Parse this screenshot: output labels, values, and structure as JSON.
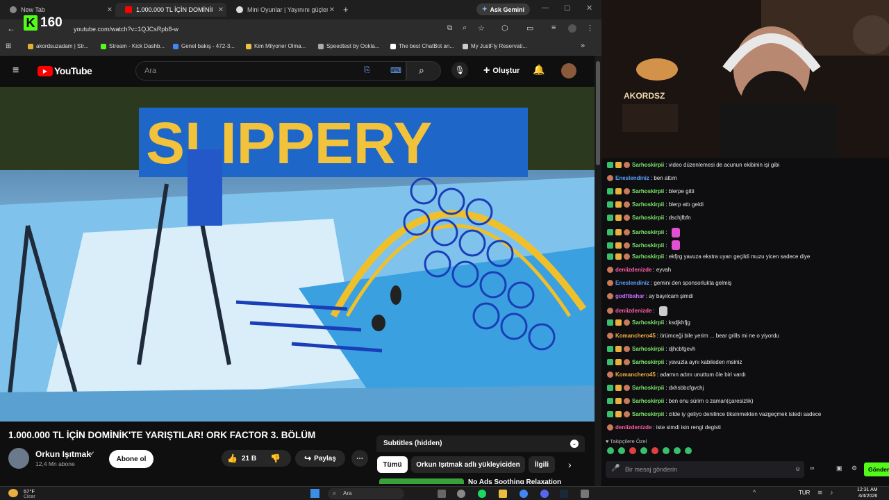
{
  "browser": {
    "tabs": [
      {
        "label": "New Tab",
        "color": "#888"
      },
      {
        "label": "1.000.000 TL İÇİN DOMİNİK",
        "color": "#ff0000"
      },
      {
        "label": "Mini Oyunlar | Yayınını güçlend",
        "color": "#ddd"
      }
    ],
    "ask_gemini": "Ask Gemini",
    "url": "youtube.com/watch?v=1QJCsRpb8-w",
    "bookmarks": [
      {
        "label": "akordsuzadam | Str...",
        "color": "#e0b030"
      },
      {
        "label": "Stream - Kick Dashb...",
        "color": "#53fc18"
      },
      {
        "label": "Genel bakış - 472-3...",
        "color": "#4285f4"
      },
      {
        "label": "Kim Milyoner Olma...",
        "color": "#f0c040"
      },
      {
        "label": "Speedtest by Ookla...",
        "color": "#aaa"
      },
      {
        "label": "The best ChatBot an...",
        "color": "#fff"
      },
      {
        "label": "My JustFly Reservati...",
        "color": "#ccc"
      }
    ]
  },
  "kick_badge": {
    "count": "160"
  },
  "youtube": {
    "logo_text": "YouTube",
    "search_placeholder": "Ara",
    "create_label": "Oluştur",
    "video_title": "1.000.000 TL İÇİN DOMİNİK'TE YARIŞTILAR! ORK FACTOR 3. BÖLÜM",
    "channel": "Orkun Işıtmak",
    "subscribers": "12,4 Mn abone",
    "subscribe_label": "Abone ol",
    "likes": "21 B",
    "share_label": "Paylaş",
    "subtitles": "Subtitles (hidden)",
    "chips": [
      "Tümü",
      "Orkun Işıtmak adlı yükleyiciden",
      "İlgili"
    ],
    "next_video": "No Ads Soothing Relaxation",
    "video_sign": "SLIPPERY"
  },
  "chat": {
    "messages": [
      {
        "user": "Sarhoskirpii",
        "text": "video düzenlemesi de acunun ekibinin işi gibi",
        "ucolor": "#7ee86b",
        "badges": true
      },
      {
        "user": "Eneslendiniz",
        "text": "ben attım",
        "ucolor": "#5aa0ff",
        "badges": false
      },
      {
        "user": "Sarhoskirpii",
        "text": "blerpe gitti",
        "ucolor": "#7ee86b",
        "badges": true
      },
      {
        "user": "Sarhoskirpii",
        "text": "blerp attı geldi",
        "ucolor": "#7ee86b",
        "badges": true
      },
      {
        "user": "Sarhoskirpii",
        "text": "dschjfbfn",
        "ucolor": "#7ee86b",
        "badges": true
      },
      {
        "user": "Sarhoskirpii",
        "text": "",
        "ucolor": "#7ee86b",
        "badges": true,
        "emote": "#e050d0"
      },
      {
        "user": "Sarhoskirpii",
        "text": "",
        "ucolor": "#7ee86b",
        "badges": true,
        "emote": "#e050d0"
      },
      {
        "user": "Sarhoskirpii",
        "text": "ekfjrg yavuza ekstra uyarı geçildi muzu yicen sadece diye",
        "ucolor": "#7ee86b",
        "badges": true
      },
      {
        "user": "deniizdenizde",
        "text": "eyvah",
        "ucolor": "#ff5fa8",
        "badges": false
      },
      {
        "user": "Eneslendiniz",
        "text": "gemini den sponsorlukta gelmiş",
        "ucolor": "#5aa0ff",
        "badges": false
      },
      {
        "user": "godftbahar",
        "text": "ay bayılcam şimdi",
        "ucolor": "#c86bff",
        "badges": false
      },
      {
        "user": "deniizdenizde",
        "text": "",
        "ucolor": "#ff5fa8",
        "badges": false,
        "emote": "#ccc"
      },
      {
        "user": "Sarhoskirpii",
        "text": "ksdjkhfjg",
        "ucolor": "#7ee86b",
        "badges": true
      },
      {
        "user": "Komanchero45",
        "text": "örümceği bile yerim ... bear grills mi ne o yiyordu",
        "ucolor": "#f5b342",
        "badges": false
      },
      {
        "user": "Sarhoskirpii",
        "text": "djhcbfgevh",
        "ucolor": "#7ee86b",
        "badges": true
      },
      {
        "user": "Sarhoskirpii",
        "text": "yavuzla aynı kabileden msiniz",
        "ucolor": "#7ee86b",
        "badges": true
      },
      {
        "user": "Komanchero45",
        "text": "adamın adını unuttum öle biri vardı",
        "ucolor": "#f5b342",
        "badges": false
      },
      {
        "user": "Sarhoskirpii",
        "text": "dxhsbbcfgvchj",
        "ucolor": "#7ee86b",
        "badges": true
      },
      {
        "user": "Sarhoskirpii",
        "text": "ben onu sürim o zaman(çaresizlik)",
        "ucolor": "#7ee86b",
        "badges": true
      },
      {
        "user": "Sarhoskirpii",
        "text": "cilde iy geliyo denilince tiksinmekten vazgeçmek istedi sadece",
        "ucolor": "#7ee86b",
        "badges": true
      },
      {
        "user": "deniizdenizde",
        "text": "iste simdi isin rengi degisti",
        "ucolor": "#ff5fa8",
        "badges": false
      }
    ],
    "followers_label": "Takipçilere Özel",
    "input_placeholder": "Bir mesaj gönderin",
    "send_label": "Gönder"
  },
  "cam_sign": "AKORDSZ",
  "taskbar": {
    "weather_temp": "57°F",
    "weather_desc": "Clear",
    "search_label": "Ara",
    "lang": "TUR",
    "time": "12:31 AM",
    "date": "4/4/2026"
  }
}
